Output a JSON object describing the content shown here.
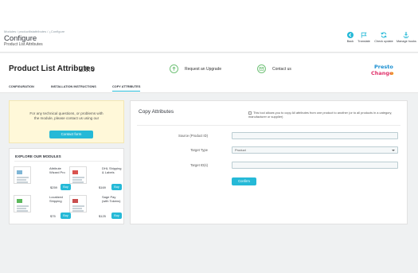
{
  "header": {
    "breadcrumb": "Modules  /  productlistattributes  /  ¿Configure",
    "title": "Configure",
    "subtitle": "Product List Attributes",
    "toolbar": [
      {
        "label": "Back",
        "icon": "back-icon"
      },
      {
        "label": "Translate",
        "icon": "flag-icon"
      },
      {
        "label": "Check update",
        "icon": "refresh-icon"
      },
      {
        "label": "Manage hooks",
        "icon": "anchor-icon"
      }
    ]
  },
  "module": {
    "name": "Product List Attributes",
    "version": "2.0.0",
    "upgrade_label": "Request an Upgrade",
    "contact_label": "Contact us",
    "logo_text": "Presto Changeo"
  },
  "tabs": [
    "CONFIGURATION",
    "INSTALLATION INSTRUCTIONS",
    "COPY ATTRIBUTES"
  ],
  "active_tab": "COPY ATTRIBUTES",
  "support": {
    "text": "For any technical questions, or problems with the module, please contact us using our",
    "button": "Contact form"
  },
  "explore": {
    "title": "EXPLORE OUR MODULES",
    "modules": [
      {
        "name": "Attribute Wizard Pro",
        "price": "$259",
        "buy": "Buy"
      },
      {
        "name": "DHL Shipping & Labels",
        "price": "$169",
        "buy": "Buy"
      },
      {
        "name": "Localized Shipping",
        "price": "$75",
        "buy": "Buy"
      },
      {
        "name": "Sage Pay (with Tokens)",
        "price": "$125",
        "buy": "Buy"
      }
    ]
  },
  "copy": {
    "title": "Copy Attributes",
    "description": "This tool allows you to copy All attributes from one product to another (or to all products in a category, manufacturer or supplier)",
    "fields": [
      {
        "label": "Source (Product ID)",
        "value": ""
      },
      {
        "label": "Target Type",
        "value": "Product"
      },
      {
        "label": "Target ID(s)",
        "value": ""
      }
    ],
    "confirm_label": "Confirm"
  },
  "colors": {
    "accent": "#25b9d7",
    "support_bg": "#fff8d9",
    "icon_green": "#72c279"
  }
}
